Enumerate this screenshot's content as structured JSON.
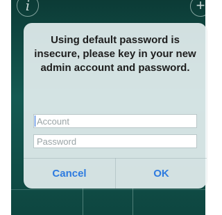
{
  "background": {
    "info_icon": "i",
    "add_icon": "+"
  },
  "dialog": {
    "message": "Using default password is insecure, please key in your new admin account and password.",
    "account_placeholder": "Account",
    "password_placeholder": "Password",
    "cancel_label": "Cancel",
    "ok_label": "OK"
  },
  "colors": {
    "accent": "#2e7be0",
    "app_background": "#145a52"
  }
}
